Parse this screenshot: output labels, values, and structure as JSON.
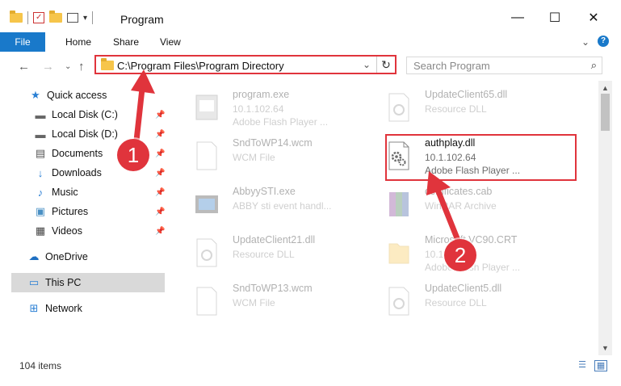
{
  "window": {
    "title": "Program",
    "controls": {
      "minimize": "—",
      "maximize": "☐",
      "close": "✕"
    }
  },
  "ribbon": {
    "tabs": [
      {
        "label": "File"
      },
      {
        "label": "Home"
      },
      {
        "label": "Share"
      },
      {
        "label": "View"
      }
    ],
    "expand_icon": "⌄",
    "help_icon": "?"
  },
  "address": {
    "path": "C:\\Program Files\\Program Directory",
    "dropdown_icon": "⌄",
    "refresh_icon": "↻"
  },
  "search": {
    "placeholder": "Search Program",
    "icon": "⌕"
  },
  "nav": {
    "back": "←",
    "forward": "→",
    "recent": "⌄",
    "up": "↑",
    "items": [
      {
        "label": "Quick access",
        "icon": "star-icon",
        "glyph": "★",
        "pinned": false
      },
      {
        "label": "Local Disk (C:)",
        "icon": "drive-icon",
        "glyph": "▬",
        "pinned": true
      },
      {
        "label": "Local Disk (D:)",
        "icon": "drive-icon",
        "glyph": "▬",
        "pinned": true
      },
      {
        "label": "Documents",
        "icon": "documents-icon",
        "glyph": "▤",
        "pinned": true
      },
      {
        "label": "Downloads",
        "icon": "download-icon",
        "glyph": "↓",
        "pinned": true
      },
      {
        "label": "Music",
        "icon": "music-icon",
        "glyph": "♪",
        "pinned": true
      },
      {
        "label": "Pictures",
        "icon": "pictures-icon",
        "glyph": "▣",
        "pinned": true
      },
      {
        "label": "Videos",
        "icon": "videos-icon",
        "glyph": "▦",
        "pinned": true
      },
      {
        "label": "OneDrive",
        "icon": "cloud-icon",
        "glyph": "☁",
        "pinned": false
      },
      {
        "label": "This PC",
        "icon": "computer-icon",
        "glyph": "▭",
        "pinned": false,
        "selected": true
      },
      {
        "label": "Network",
        "icon": "network-icon",
        "glyph": "⊞",
        "pinned": false
      }
    ]
  },
  "files": [
    {
      "name": "program.exe",
      "line2": "10.1.102.64",
      "line3": "Adobe Flash Player ...",
      "icon": "exe-icon",
      "faded": true
    },
    {
      "name": "UpdateClient65.dll",
      "line2": "Resource DLL",
      "line3": "",
      "icon": "dll-icon",
      "faded": true
    },
    {
      "name": "SndToWP14.wcm",
      "line2": "WCM File",
      "line3": "",
      "icon": "file-icon",
      "faded": true
    },
    {
      "name": "authplay.dll",
      "line2": "10.1.102.64",
      "line3": "Adobe Flash Player ...",
      "icon": "dll-gear-icon",
      "faded": false
    },
    {
      "name": "AbbyySTI.exe",
      "line2": "ABBY sti event handl...",
      "line3": "",
      "icon": "app-icon",
      "faded": true
    },
    {
      "name": "certificates.cab",
      "line2": "WinRAR Archive",
      "line3": "",
      "icon": "archive-icon",
      "faded": true
    },
    {
      "name": "UpdateClient21.dll",
      "line2": "Resource DLL",
      "line3": "",
      "icon": "dll-icon",
      "faded": true
    },
    {
      "name": "Microsoft.VC90.CRT",
      "line2": "10.1.102.64",
      "line3": "Adobe Flash Player ...",
      "icon": "folder-icon",
      "faded": true
    },
    {
      "name": "SndToWP13.wcm",
      "line2": "WCM File",
      "line3": "",
      "icon": "file-icon",
      "faded": true
    },
    {
      "name": "UpdateClient5.dll",
      "line2": "Resource DLL",
      "line3": "",
      "icon": "dll-icon",
      "faded": true
    }
  ],
  "status": {
    "count": "104 items",
    "details_view_icon": "☰",
    "tiles_view_icon": "▦"
  },
  "annotations": {
    "badge_1": "1",
    "badge_2": "2",
    "color": "#e0343c"
  }
}
